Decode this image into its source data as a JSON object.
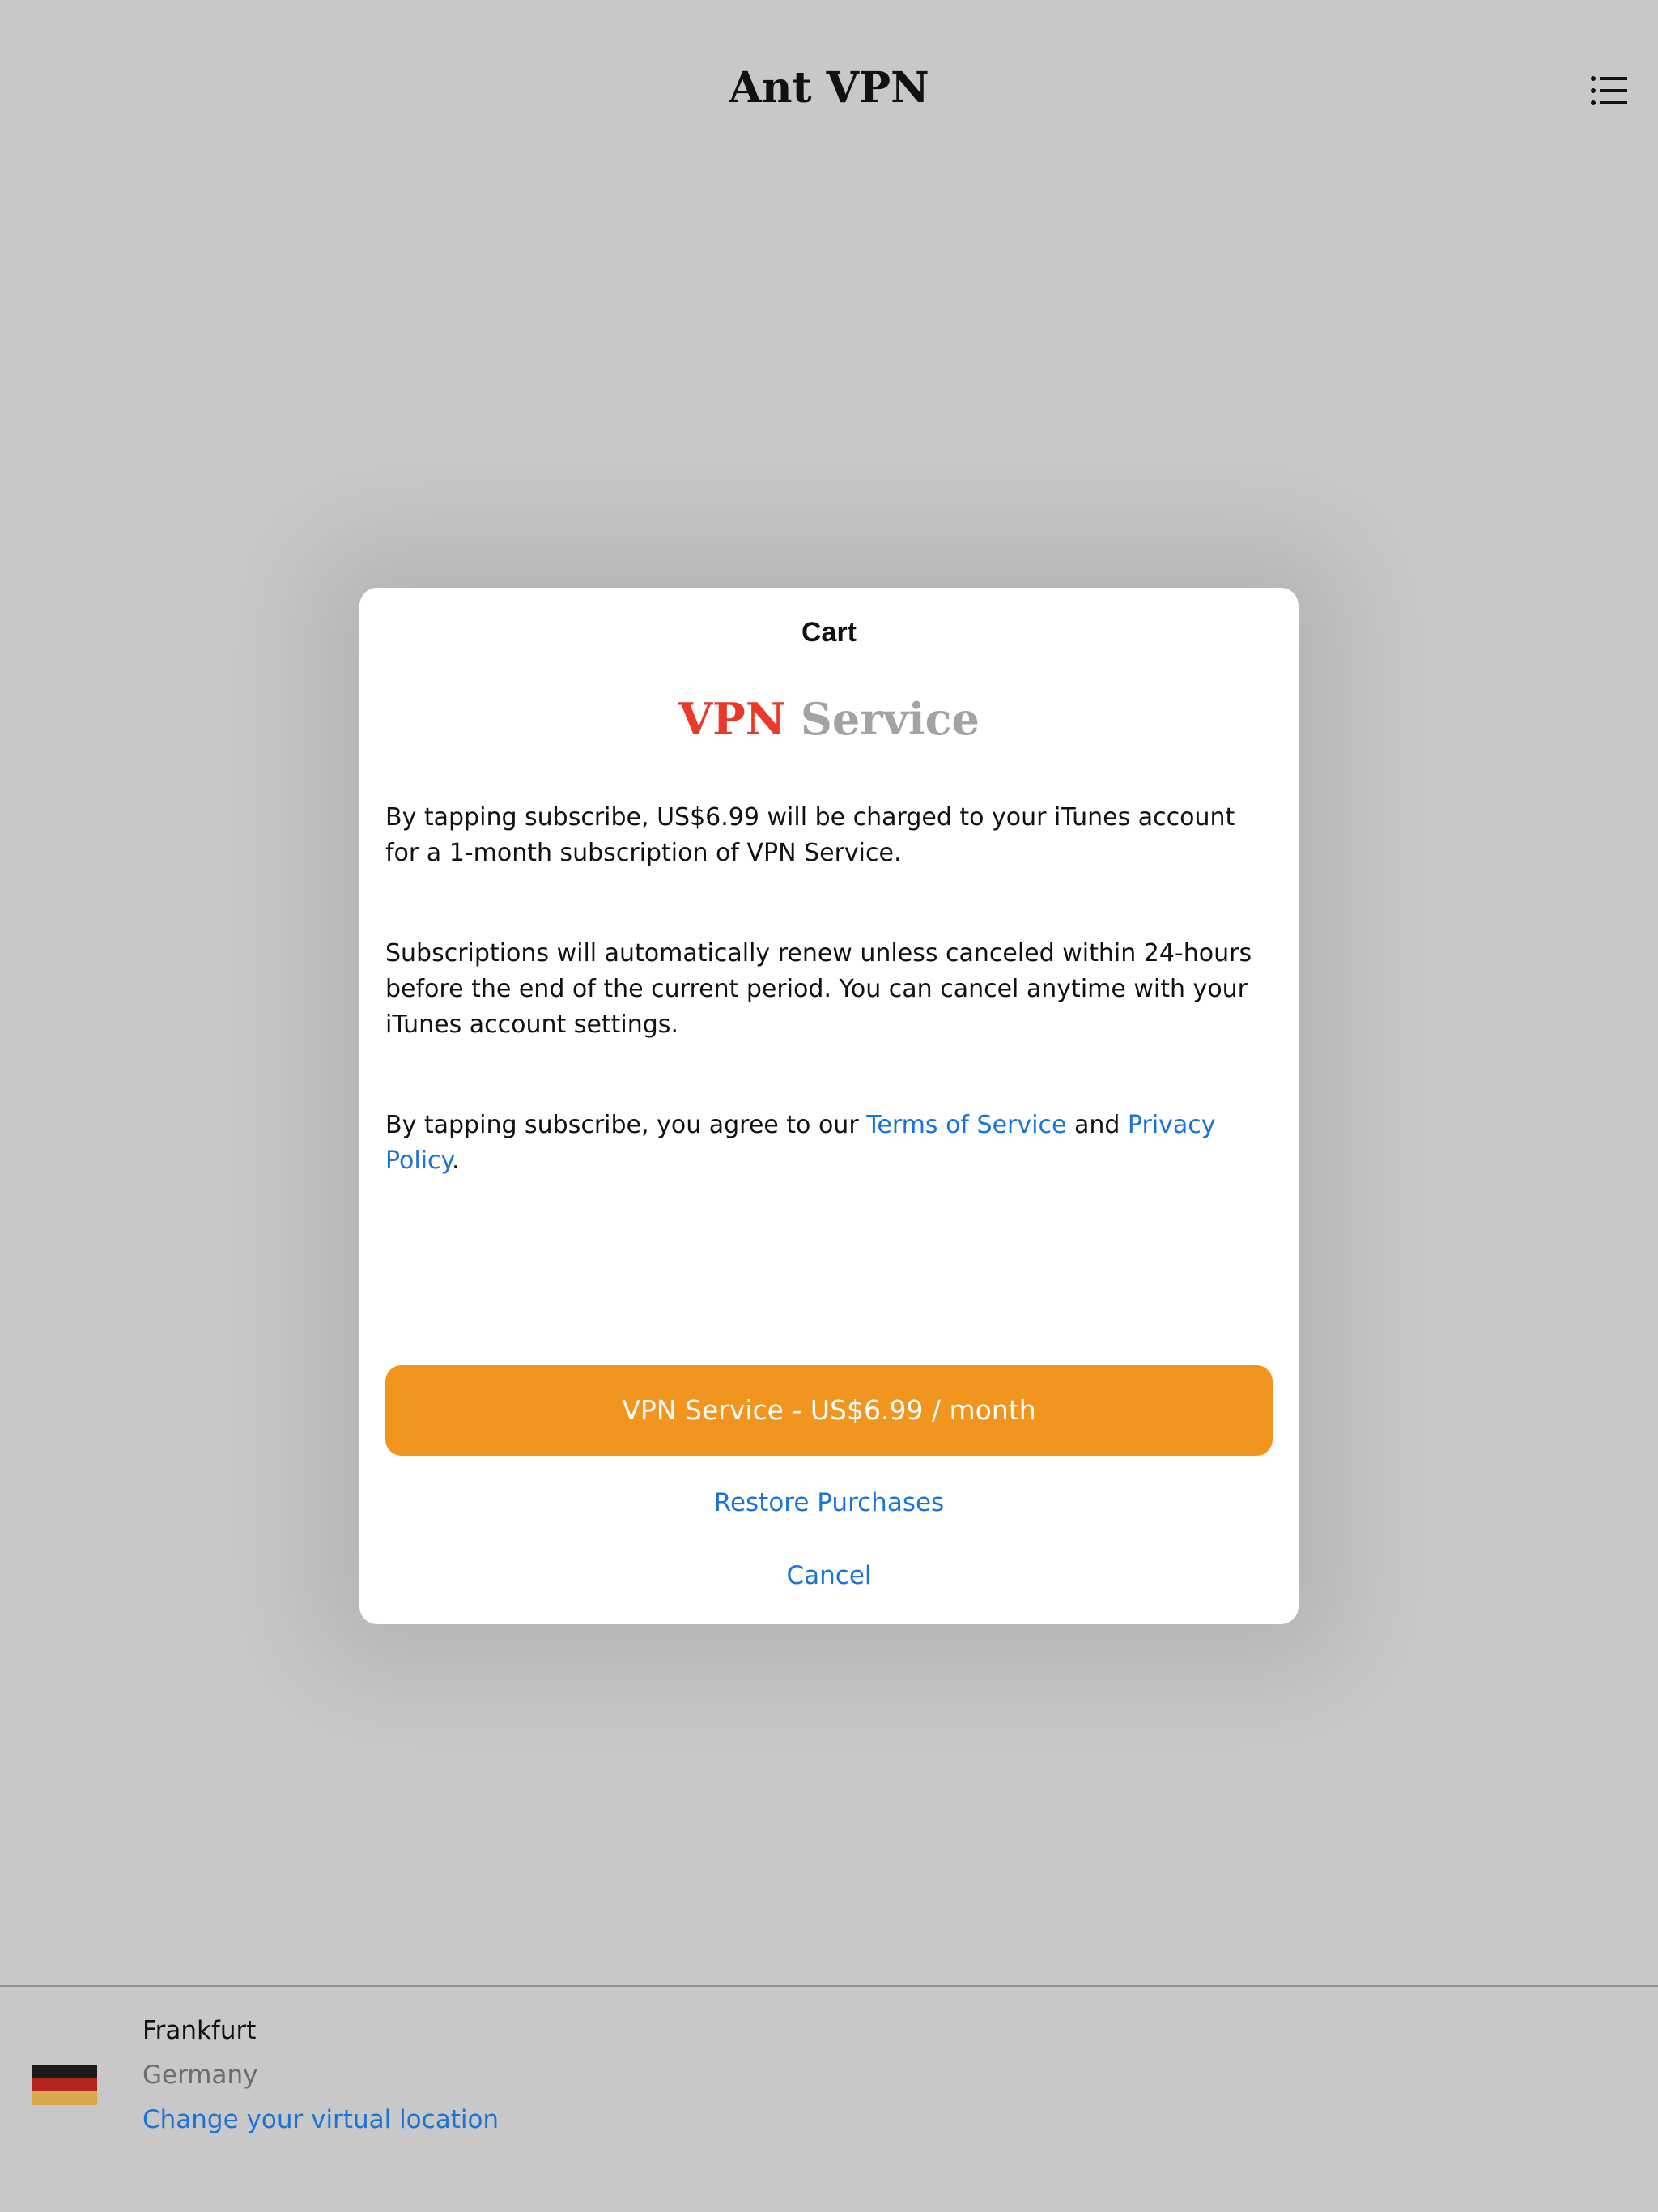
{
  "header": {
    "app_title": "Ant VPN",
    "menu_icon": "list-menu-icon"
  },
  "modal": {
    "title": "Cart",
    "product_logo_part1": "VPN",
    "product_logo_part2": "Service",
    "paragraph1": "By tapping subscribe, US$6.99 will be charged to your iTunes account for a 1-month subscription of VPN Service.",
    "paragraph2": "Subscriptions will automatically renew unless canceled within 24-hours before the end of the current period. You can cancel anytime with your iTunes account settings.",
    "paragraph3_prefix": "By tapping subscribe, you agree to our ",
    "terms_link": "Terms of Service",
    "paragraph3_and": " and ",
    "privacy_link": "Privacy Policy",
    "paragraph3_suffix": ".",
    "subscribe_button": "VPN Service - US$6.99 / month",
    "restore_button": "Restore Purchases",
    "cancel_button": "Cancel"
  },
  "location": {
    "city": "Frankfurt",
    "country": "Germany",
    "change_link": "Change your virtual location",
    "flag_icon": "germany-flag-icon"
  },
  "colors": {
    "background": "#c8c8c8",
    "accent_orange": "#f2951e",
    "link_blue": "#1a73d9",
    "logo_red": "#e8392a",
    "logo_gray": "#a3a3a3"
  }
}
